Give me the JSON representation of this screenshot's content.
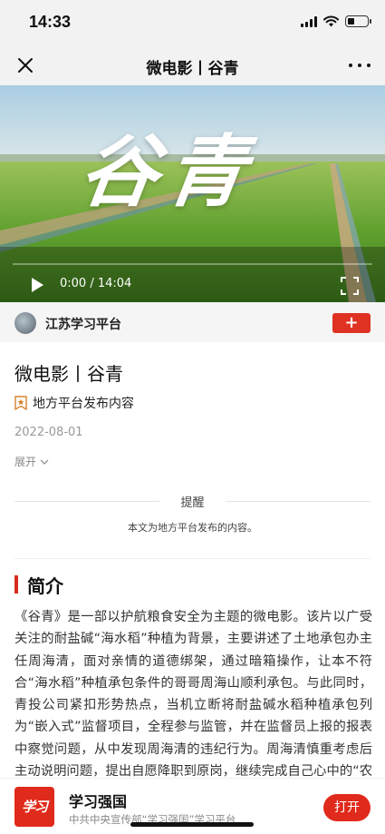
{
  "status_bar": {
    "time": "14:33",
    "signal_icon": "cellular-signal-icon",
    "wifi_icon": "wifi-icon",
    "battery_icon": "battery-icon",
    "battery_level": 0.35
  },
  "nav": {
    "title": "微电影丨谷青",
    "close_icon": "close-icon",
    "more_icon": "more-icon"
  },
  "video": {
    "title_text": "谷青",
    "time": "0:00 / 14:04",
    "progress": 0,
    "play_icon": "play-icon",
    "fullscreen_icon": "fullscreen-icon"
  },
  "source": {
    "name": "江苏学习平台",
    "follow_label": "+"
  },
  "article": {
    "title": "微电影丨谷青",
    "tag": "地方平台发布内容",
    "date": "2022-08-01",
    "expand_label": "展开"
  },
  "reminder": {
    "label": "提醒",
    "text": "本文为地方平台发布的内容。"
  },
  "intro": {
    "heading": "简介",
    "body": "《谷青》是一部以护航粮食安全为主题的微电影。该片以广受关注的耐盐碱“海水稻”种植为背景，主要讲述了土地承包办主任周海清，面对亲情的道德绑架，通过暗箱操作，让本不符合“海水稻”种植承包条件的哥哥周海山顺利承包。与此同时，青投公司紧扣形势热点，当机立断将耐盐碱水稻种植承包列为“嵌入式”监督项目，全程参与监管，并在监督员上报的报表中察觉问题，从中发现周海清的违纪行为。周海清慎重考虑后主动说明问题，提出自愿降职到原岗，继续完成自己心中的“农业梦”。周海清党员干部在权力面前不忘初心，守住底线，做到廉洁自律。"
  },
  "app_banner": {
    "logo_text": "学习",
    "name": "学习强国",
    "desc": "中共中央宣传部“学习强国”学习平台",
    "open_label": "打开"
  },
  "colors": {
    "accent_red": "#e02a1b",
    "bar_bg": "#f2f2f2"
  }
}
